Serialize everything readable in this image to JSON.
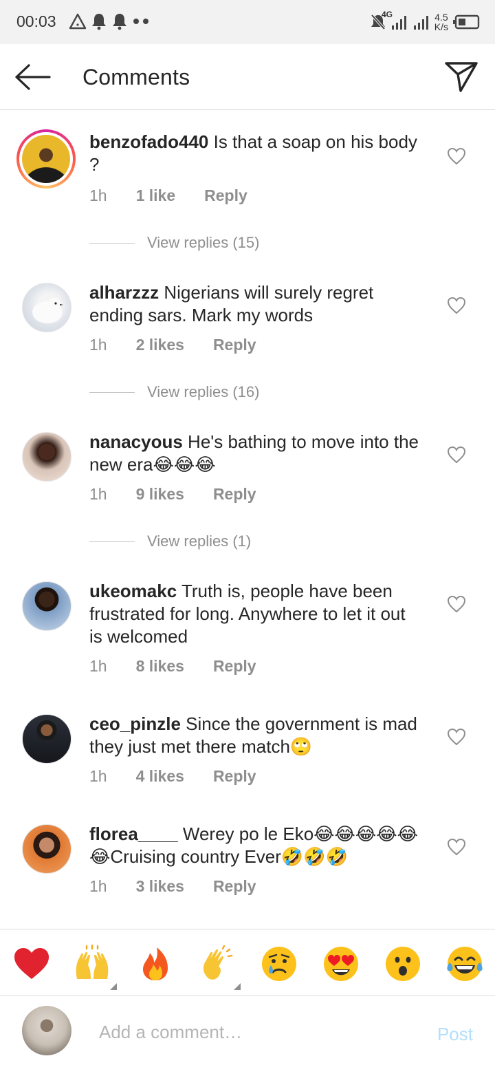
{
  "status_bar": {
    "time": "00:03",
    "network": "4G",
    "speed_value": "4.5",
    "speed_unit": "K/s"
  },
  "header": {
    "title": "Comments"
  },
  "comments": [
    {
      "username": "benzofado440",
      "text": " Is that a soap on his body ?",
      "time": "1h",
      "likes": "1 like",
      "reply": "Reply",
      "replies_label": "View replies (15)"
    },
    {
      "username": "alharzzz",
      "text": " Nigerians will surely regret ending sars. Mark my words",
      "time": "1h",
      "likes": "2 likes",
      "reply": "Reply",
      "replies_label": "View replies (16)"
    },
    {
      "username": "nanacyous",
      "text": " He's bathing to move into the new era😂😂😂",
      "time": "1h",
      "likes": "9 likes",
      "reply": "Reply",
      "replies_label": "View replies (1)"
    },
    {
      "username": "ukeomakc",
      "text": " Truth is, people have been frustrated for long. Anywhere to let it out is welcomed",
      "time": "1h",
      "likes": "8 likes",
      "reply": "Reply"
    },
    {
      "username": "ceo_pinzle",
      "text": " Since the government is mad they just met there match🙄",
      "time": "1h",
      "likes": "4 likes",
      "reply": "Reply"
    },
    {
      "username": "florea____",
      "text": " Werey po le Eko😂😂😂😂😂😂Cruising country Ever🤣🤣🤣",
      "time": "1h",
      "likes": "3 likes",
      "reply": "Reply"
    }
  ],
  "emoji_bar": [
    "❤️",
    "🙌",
    "🔥",
    "👏",
    "😢",
    "😍",
    "😮",
    "😂"
  ],
  "composer": {
    "placeholder": "Add a comment…",
    "post_label": "Post"
  },
  "colors": {
    "accent_ring_start": "#d6249f",
    "accent_ring_end": "#fdc468",
    "post_disabled": "#b2dffc",
    "meta_grey": "#8e8e8e"
  }
}
